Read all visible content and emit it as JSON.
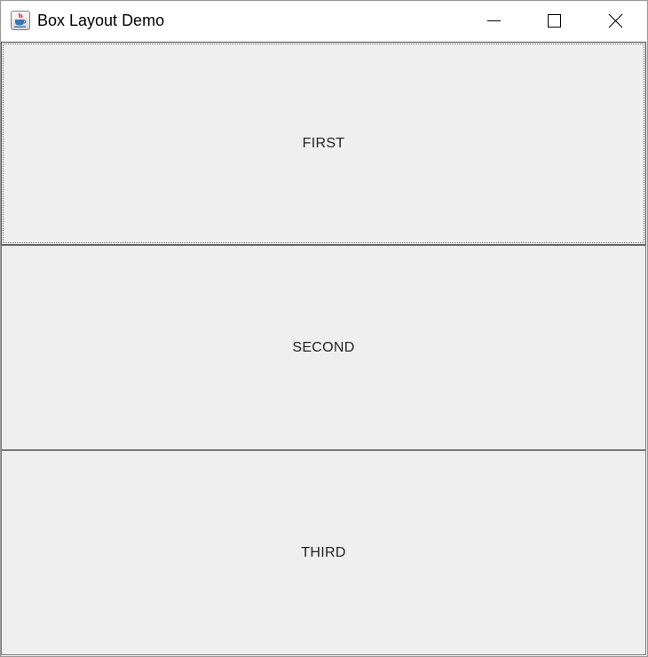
{
  "window": {
    "title": "Box Layout Demo",
    "app_icon": "java-coffee-cup-icon",
    "controls": [
      "minimize-icon",
      "maximize-icon",
      "close-icon"
    ]
  },
  "buttons": [
    {
      "label": "FIRST",
      "focused": true
    },
    {
      "label": "SECOND",
      "focused": false
    },
    {
      "label": "THIRD",
      "focused": false
    }
  ],
  "colors": {
    "content_background": "#f0f0f0",
    "button_border": "#7a7a7a",
    "label_text": "#222222"
  }
}
